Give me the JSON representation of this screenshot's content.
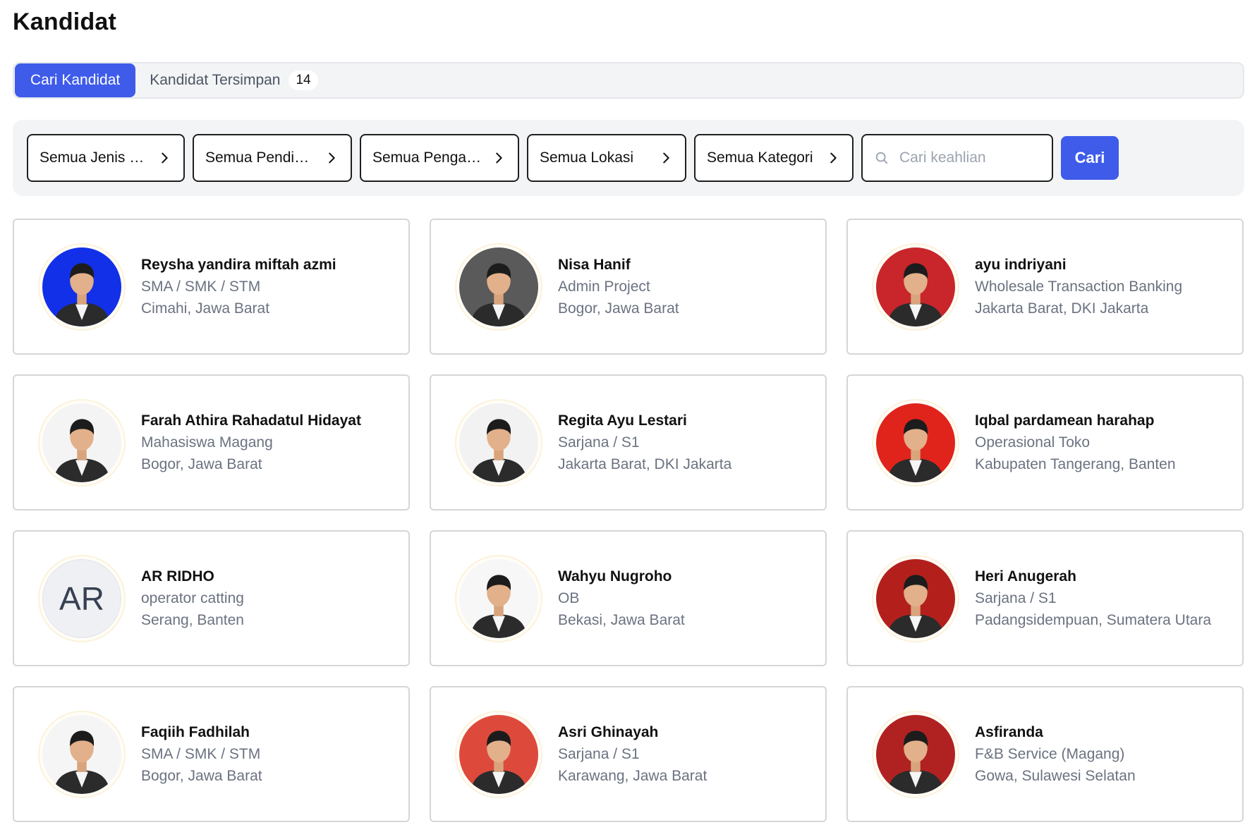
{
  "page": {
    "title": "Kandidat"
  },
  "tabs": {
    "search_label": "Cari Kandidat",
    "saved_label": "Kandidat Tersimpan",
    "saved_count": "14"
  },
  "filters": {
    "gender": "Semua Jenis Kelam...",
    "education": "Semua Pendidikan",
    "experience": "Semua Pengalaman",
    "location": "Semua Lokasi",
    "category": "Semua Kategori",
    "skill_placeholder": "Cari keahlian",
    "search_button": "Cari"
  },
  "candidates": [
    {
      "name": "Reysha yandira miftah azmi",
      "role": "SMA / SMK / STM",
      "location": "Cimahi, Jawa Barat",
      "photo_bg": "#1230e8"
    },
    {
      "name": "Nisa Hanif",
      "role": "Admin Project",
      "location": "Bogor, Jawa Barat",
      "photo_bg": "#5a5a5a"
    },
    {
      "name": "ayu indriyani",
      "role": "Wholesale Transaction Banking",
      "location": "Jakarta Barat, DKI Jakarta",
      "photo_bg": "#c8262a"
    },
    {
      "name": "Farah Athira Rahadatul Hidayat",
      "role": "Mahasiswa Magang",
      "location": "Bogor, Jawa Barat",
      "photo_bg": "#f4f4f4"
    },
    {
      "name": "Regita Ayu Lestari",
      "role": "Sarjana / S1",
      "location": "Jakarta Barat, DKI Jakarta",
      "photo_bg": "#f2f2f2"
    },
    {
      "name": "Iqbal pardamean harahap",
      "role": "Operasional Toko",
      "location": "Kabupaten Tangerang, Banten",
      "photo_bg": "#e0241c"
    },
    {
      "name": "AR RIDHO",
      "role": "operator catting",
      "location": "Serang, Banten",
      "initials": "AR"
    },
    {
      "name": "Wahyu Nugroho",
      "role": "OB",
      "location": "Bekasi, Jawa Barat",
      "photo_bg": "#f7f7f7"
    },
    {
      "name": "Heri Anugerah",
      "role": "Sarjana / S1",
      "location": "Padangsidempuan, Sumatera Utara",
      "photo_bg": "#b3201c"
    },
    {
      "name": "Faqiih Fadhilah",
      "role": "SMA / SMK / STM",
      "location": "Bogor, Jawa Barat",
      "photo_bg": "#f5f5f5"
    },
    {
      "name": "Asri Ghinayah",
      "role": "Sarjana / S1",
      "location": "Karawang, Jawa Barat",
      "photo_bg": "#dd4a3c"
    },
    {
      "name": "Asfiranda",
      "role": "F&B Service (Magang)",
      "location": "Gowa, Sulawesi Selatan",
      "photo_bg": "#b02222"
    }
  ]
}
